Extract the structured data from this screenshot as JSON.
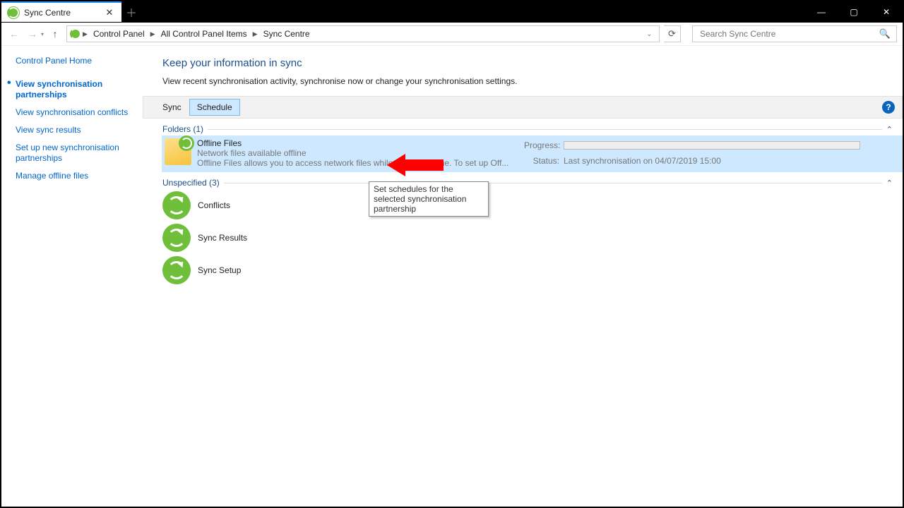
{
  "tab": {
    "title": "Sync Centre"
  },
  "breadcrumb": {
    "items": [
      "Control Panel",
      "All Control Panel Items",
      "Sync Centre"
    ]
  },
  "search": {
    "placeholder": "Search Sync Centre"
  },
  "sidebar": {
    "home": "Control Panel Home",
    "items": [
      "View synchronisation partnerships",
      "View synchronisation conflicts",
      "View sync results",
      "Set up new synchronisation partnerships",
      "Manage offline files"
    ]
  },
  "main": {
    "heading": "Keep your information in sync",
    "subtext": "View recent synchronisation activity, synchronise now or change your synchronisation settings.",
    "cmd": {
      "sync": "Sync",
      "schedule": "Schedule"
    },
    "tooltip": "Set schedules for the selected synchronisation partnership",
    "groups": {
      "folders": {
        "header": "Folders (1)",
        "item": {
          "title": "Offline Files",
          "sub1": "Network files available offline",
          "sub2": "Offline Files allows you to access network files while working offline. To set up Off...",
          "progressLabel": "Progress:",
          "statusLabel": "Status:",
          "statusValue": "Last synchronisation on 04/07/2019 15:00"
        }
      },
      "unspecified": {
        "header": "Unspecified (3)",
        "items": [
          "Conflicts",
          "Sync Results",
          "Sync Setup"
        ]
      }
    }
  }
}
